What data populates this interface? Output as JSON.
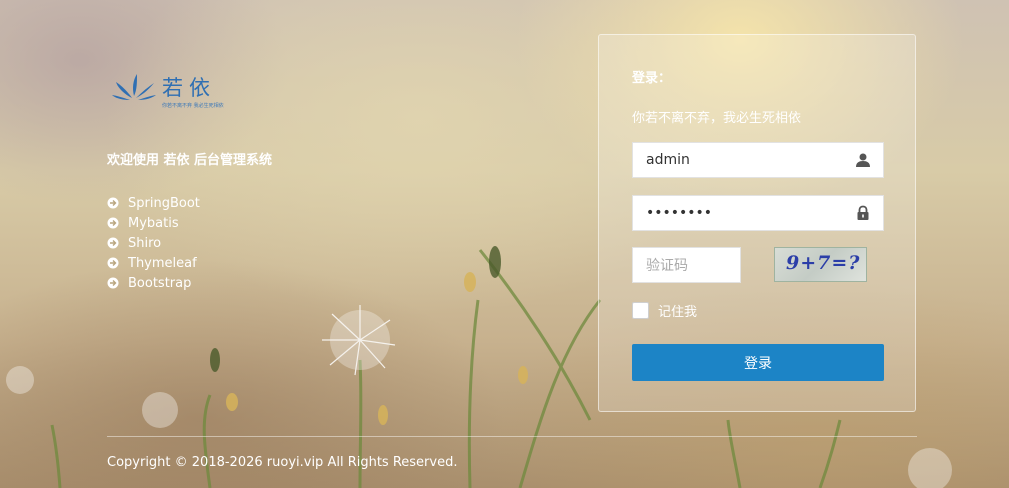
{
  "brand": {
    "name": "若依",
    "tagline": "你若不离不弃 我必生死相依"
  },
  "left": {
    "welcome": "欢迎使用 若依 后台管理系统",
    "technologies": [
      "SpringBoot",
      "Mybatis",
      "Shiro",
      "Thymeleaf",
      "Bootstrap"
    ],
    "tech_icon": "circle-arrow-right-icon"
  },
  "login": {
    "title": "登录：",
    "subtitle": "你若不离不弃，我必生死相依",
    "username_value": "admin",
    "username_icon": "user-icon",
    "password_value": "••••••••",
    "password_icon": "lock-icon",
    "captcha_placeholder": "验证码",
    "captcha_image_text": "9+7=?",
    "remember_label": "记住我",
    "remember_checked": false,
    "submit_label": "登录",
    "accent_color": "#1c84c6"
  },
  "footer": {
    "copyright": "Copyright © 2018-2026 ruoyi.vip All Rights Reserved."
  }
}
